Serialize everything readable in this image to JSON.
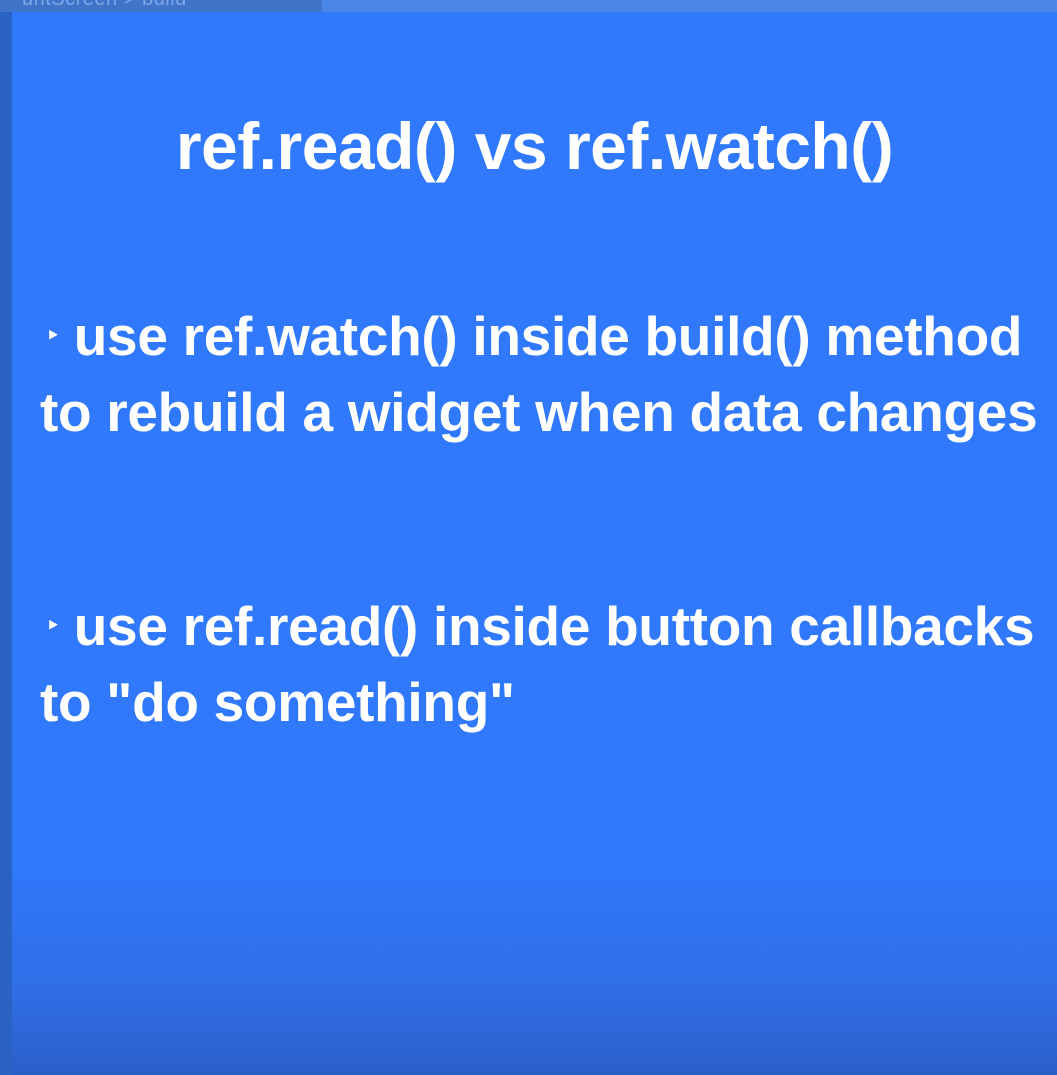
{
  "editor": {
    "breadcrumb_left": "untScreen",
    "breadcrumb_separator": ">",
    "breadcrumb_right": "build"
  },
  "slide": {
    "title": "ref.read() vs ref.watch()",
    "bullets": [
      {
        "marker": "‣",
        "text": "use ref.watch() inside build() method to rebuild a widget when data changes"
      },
      {
        "marker": "‣",
        "text": "use ref.read() inside button callbacks to \"do something\""
      }
    ]
  },
  "colors": {
    "slide_background": "#3079fc",
    "text": "#ffffff"
  }
}
